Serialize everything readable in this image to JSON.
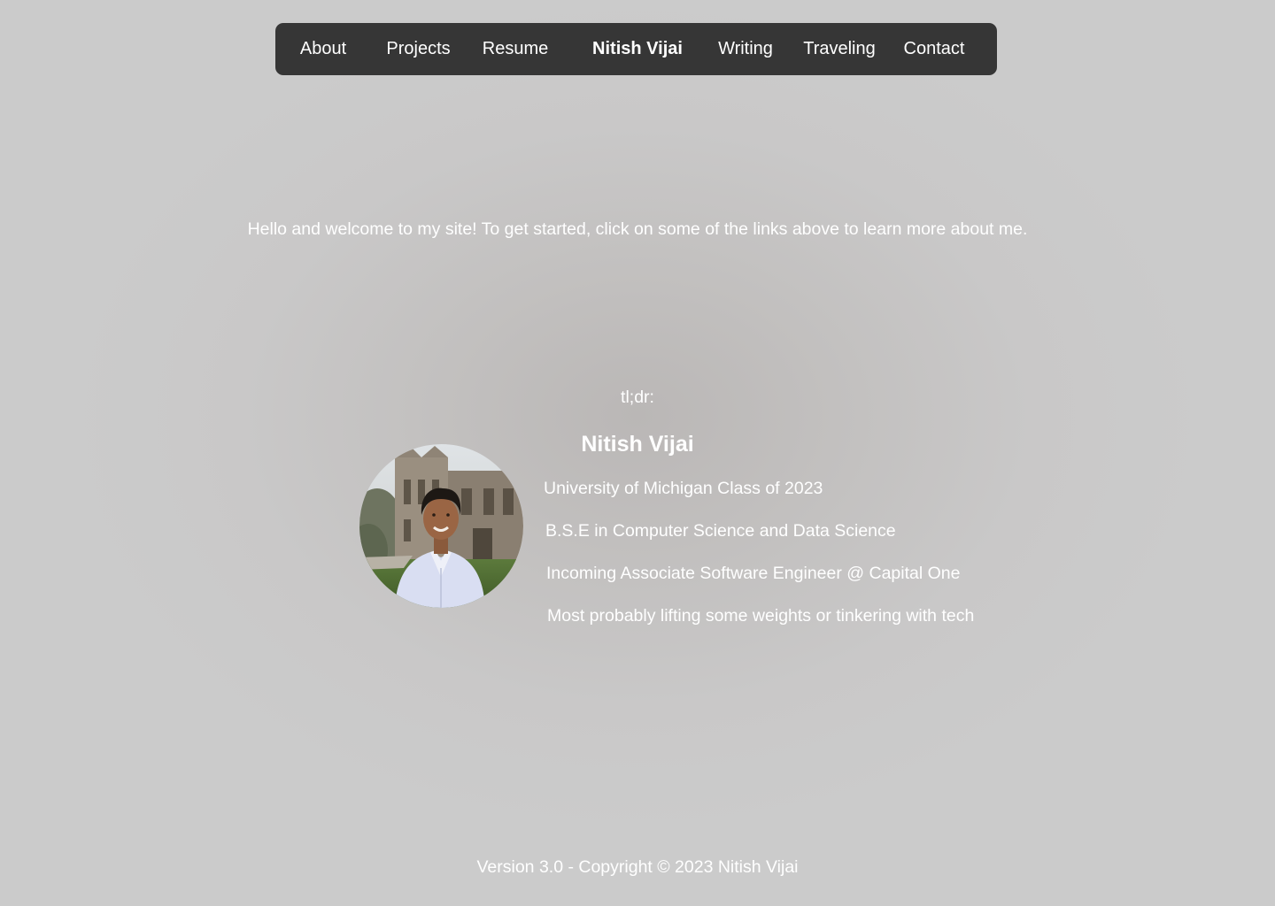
{
  "nav": {
    "items": [
      {
        "label": "About"
      },
      {
        "label": "Projects"
      },
      {
        "label": "Resume"
      },
      {
        "label": "Nitish Vijai"
      },
      {
        "label": "Writing"
      },
      {
        "label": "Traveling"
      },
      {
        "label": "Contact"
      }
    ]
  },
  "welcome": {
    "text": "Hello and welcome to my site! To get started, click on some of the links above to learn more about me."
  },
  "profile": {
    "tldr": "tl;dr:",
    "name": "Nitish Vijai",
    "lines": [
      "University of Michigan Class of 2023",
      "B.S.E in Computer Science and Data Science",
      "Incoming Associate Software Engineer @ Capital One",
      "Most probably lifting some weights or tinkering with tech"
    ]
  },
  "footer": {
    "text": "Version 3.0 - Copyright © 2023 Nitish Vijai"
  },
  "colors": {
    "nav_background": "#363636",
    "text": "#ffffff",
    "page_background": "#cbcbcb"
  }
}
